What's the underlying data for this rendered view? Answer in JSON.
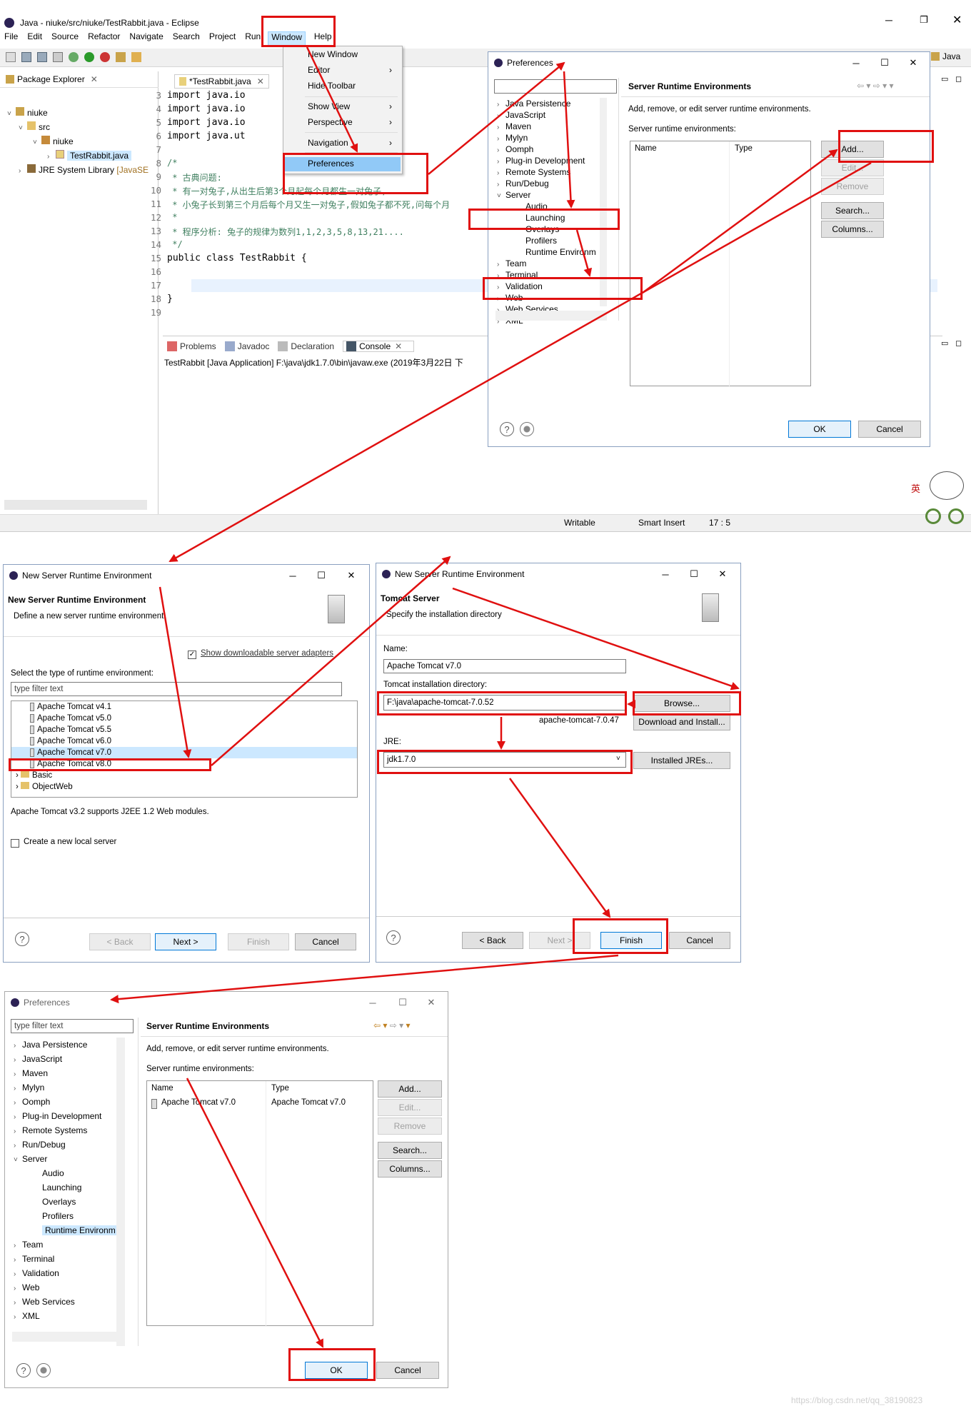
{
  "eclipse": {
    "title": "Java - niuke/src/niuke/TestRabbit.java - Eclipse",
    "menu": [
      "File",
      "Edit",
      "Source",
      "Refactor",
      "Navigate",
      "Search",
      "Project",
      "Run",
      "Window",
      "Help"
    ],
    "perspective": "Java",
    "package_explorer": {
      "title": "Package Explorer",
      "tree": [
        "niuke",
        "src",
        "niuke",
        "TestRabbit.java",
        "JRE System Library",
        "[JavaSE"
      ]
    },
    "editor_tab": "*TestRabbit.java",
    "code_lines": [
      {
        "n": "3",
        "text": "import java.io"
      },
      {
        "n": "4",
        "text": "import java.io"
      },
      {
        "n": "5",
        "text": "import java.io"
      },
      {
        "n": "6",
        "text": "import java.ut"
      },
      {
        "n": "7",
        "text": ""
      },
      {
        "n": "8",
        "text": "/*"
      },
      {
        "n": "9",
        "text": " * 古典问题:"
      },
      {
        "n": "10",
        "text": " * 有一对兔子,从出生后第3个月起每个月都生一对兔子,"
      },
      {
        "n": "11",
        "text": " * 小兔子长到第三个月后每个月又生一对兔子,假如兔子都不死,问每个月"
      },
      {
        "n": "12",
        "text": " *"
      },
      {
        "n": "13",
        "text": " * 程序分析: 兔子的规律为数列1,1,2,3,5,8,13,21...."
      },
      {
        "n": "14",
        "text": " */"
      },
      {
        "n": "15",
        "text": "public class TestRabbit {"
      },
      {
        "n": "16",
        "text": ""
      },
      {
        "n": "17",
        "text": ""
      },
      {
        "n": "18",
        "text": "}"
      },
      {
        "n": "19",
        "text": ""
      }
    ],
    "bottom_tabs": [
      "Problems",
      "Javadoc",
      "Declaration",
      "Console"
    ],
    "console_text": "TestRabbit [Java Application] F:\\java\\jdk1.7.0\\bin\\javaw.exe (2019年3月22日 下",
    "status": {
      "writable": "Writable",
      "insert": "Smart Insert",
      "pos": "17 : 5"
    },
    "window_menu": [
      "New Window",
      "Editor",
      "Hide Toolbar",
      "Show View",
      "Perspective",
      "Navigation",
      "Preferences"
    ],
    "ime": "英"
  },
  "prefs1": {
    "title": "Preferences",
    "tree": [
      "Java Persistence",
      "JavaScript",
      "Maven",
      "Mylyn",
      "Oomph",
      "Plug-in Development",
      "Remote Systems",
      "Run/Debug",
      "Server",
      "Audio",
      "Launching",
      "Overlays",
      "Profilers",
      "Runtime Environm",
      "Team",
      "Terminal",
      "Validation",
      "Web",
      "Web Services",
      "XML"
    ],
    "page_title": "Server Runtime Environments",
    "desc": "Add, remove, or edit server runtime environments.",
    "list_label": "Server runtime environments:",
    "cols": [
      "Name",
      "Type"
    ],
    "buttons": [
      "Add...",
      "Edit...",
      "Remove",
      "Search...",
      "Columns..."
    ],
    "ok": "OK",
    "cancel": "Cancel"
  },
  "nsre1": {
    "title": "New Server Runtime Environment",
    "heading": "New Server Runtime Environment",
    "desc": "Define a new server runtime environment",
    "show_adapters": "Show downloadable server adapters",
    "select_label": "Select the type of runtime environment:",
    "filter_placeholder": "type filter text",
    "items": [
      "Apache Tomcat v4.1",
      "Apache Tomcat v5.0",
      "Apache Tomcat v5.5",
      "Apache Tomcat v6.0",
      "Apache Tomcat v7.0",
      "Apache Tomcat v8.0",
      "Basic",
      "ObjectWeb"
    ],
    "info": "Apache Tomcat v3.2 supports J2EE 1.2 Web modules.",
    "create_local": "Create a new local server",
    "back": "< Back",
    "next": "Next >",
    "finish": "Finish",
    "cancel": "Cancel"
  },
  "nsre2": {
    "title": "New Server Runtime Environment",
    "heading": "Tomcat Server",
    "desc": "Specify the installation directory",
    "name_label": "Name:",
    "name_value": "Apache Tomcat v7.0",
    "dir_label": "Tomcat installation directory:",
    "dir_value": "F:\\java\\apache-tomcat-7.0.52",
    "browse": "Browse...",
    "ver_hint": "apache-tomcat-7.0.47",
    "download": "Download and Install...",
    "jre_label": "JRE:",
    "jre_value": "jdk1.7.0",
    "installed_jres": "Installed JREs...",
    "back": "< Back",
    "next": "Next >",
    "finish": "Finish",
    "cancel": "Cancel"
  },
  "prefs2": {
    "title": "Preferences",
    "filter_placeholder": "type filter text",
    "tree": [
      "Java Persistence",
      "JavaScript",
      "Maven",
      "Mylyn",
      "Oomph",
      "Plug-in Development",
      "Remote Systems",
      "Run/Debug",
      "Server",
      "Audio",
      "Launching",
      "Overlays",
      "Profilers",
      "Runtime Environm",
      "Team",
      "Terminal",
      "Validation",
      "Web",
      "Web Services",
      "XML"
    ],
    "page_title": "Server Runtime Environments",
    "desc": "Add, remove, or edit server runtime environments.",
    "list_label": "Server runtime environments:",
    "cols": [
      "Name",
      "Type"
    ],
    "row": {
      "name": "Apache Tomcat v7.0",
      "type": "Apache Tomcat v7.0"
    },
    "buttons": [
      "Add...",
      "Edit...",
      "Remove",
      "Search...",
      "Columns..."
    ],
    "ok": "OK",
    "cancel": "Cancel"
  },
  "watermark": "https://blog.csdn.net/qq_38190823",
  "colors": {
    "annotation": "#e01010",
    "selection": "#cce8ff",
    "win_border": "#8aa0c0"
  }
}
